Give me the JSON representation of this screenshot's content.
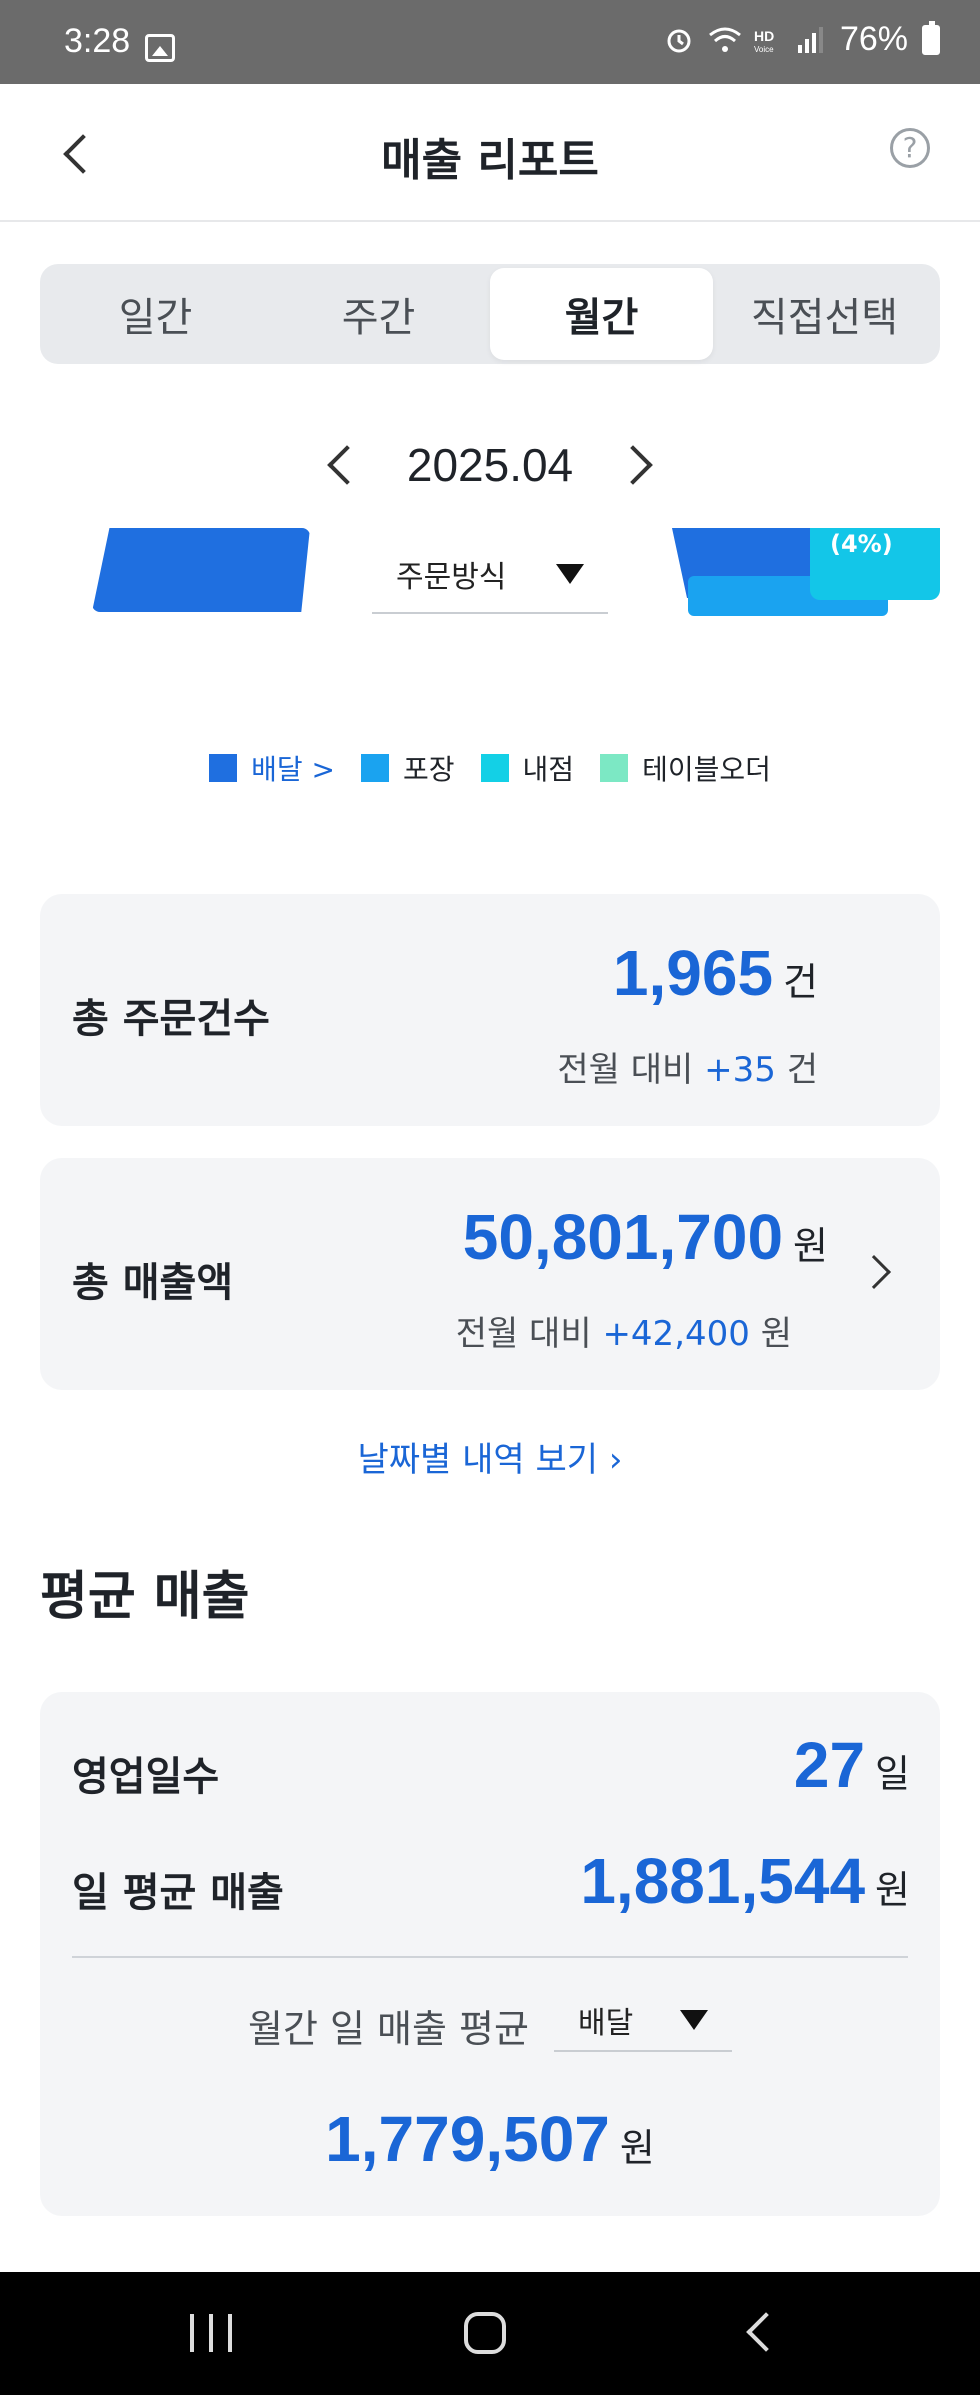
{
  "status_bar": {
    "time": "3:28",
    "battery": "76%",
    "icons": [
      "gallery-icon",
      "alarm-icon",
      "wifi-icon",
      "hd-voice-icon",
      "signal-icon",
      "battery-icon"
    ]
  },
  "header": {
    "title": "매출 리포트",
    "back_icon": "chevron-left-icon",
    "help_icon": "help-icon",
    "help_glyph": "?"
  },
  "period_tabs": [
    {
      "label": "일간",
      "active": false
    },
    {
      "label": "주간",
      "active": false
    },
    {
      "label": "월간",
      "active": true
    },
    {
      "label": "직접선택",
      "active": false
    }
  ],
  "month_nav": {
    "label": "2025.04"
  },
  "chart": {
    "filter_label": "주문방식",
    "visible_percent": "(4%)"
  },
  "legend": [
    {
      "label": "배달 >",
      "color": "#1f6fe0",
      "active": true
    },
    {
      "label": "포장",
      "color": "#1aa3f0",
      "active": false
    },
    {
      "label": "내점",
      "color": "#13d0e6",
      "active": false
    },
    {
      "label": "테이블오더",
      "color": "#7ce8c4",
      "active": false
    }
  ],
  "total_orders": {
    "title": "총 주문건수",
    "value": "1,965",
    "unit": "건",
    "compare_label": "전월 대비",
    "delta": "+35",
    "delta_unit": "건"
  },
  "total_sales": {
    "title": "총 매출액",
    "value": "50,801,700",
    "unit": "원",
    "compare_label": "전월 대비",
    "delta": "+42,400",
    "delta_unit": "원"
  },
  "date_link": "날짜별 내역 보기 ›",
  "average": {
    "section_title": "평균 매출",
    "business_days_label": "영업일수",
    "business_days_value": "27",
    "business_days_unit": "일",
    "daily_avg_label": "일 평균 매출",
    "daily_avg_value": "1,881,544",
    "daily_avg_unit": "원",
    "monthly_label": "월간 일 매출 평균",
    "monthly_filter": "배달",
    "monthly_value": "1,779,507",
    "monthly_unit": "원"
  },
  "nav_bar": {
    "icons": [
      "recent-apps-icon",
      "home-icon",
      "back-icon"
    ]
  }
}
